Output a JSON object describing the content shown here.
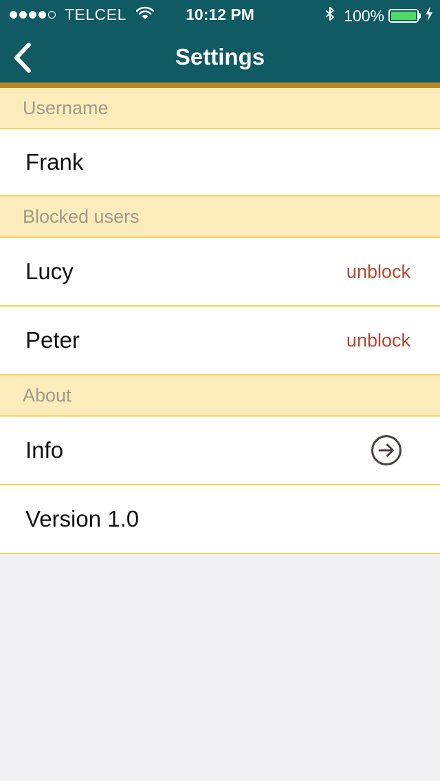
{
  "status_bar": {
    "carrier": "TELCEL",
    "signal_dots_filled": 4,
    "signal_dots_total": 5,
    "time": "10:12 PM",
    "battery_percent": "100%",
    "icons": [
      "wifi-icon",
      "bluetooth-icon",
      "battery-icon",
      "charging-bolt-icon"
    ]
  },
  "nav": {
    "title": "Settings",
    "back_icon": "chevron-left-icon"
  },
  "sections": {
    "username": {
      "header": "Username",
      "value": "Frank"
    },
    "blocked": {
      "header": "Blocked users",
      "users": [
        {
          "name": "Lucy",
          "action": "unblock"
        },
        {
          "name": "Peter",
          "action": "unblock"
        }
      ]
    },
    "about": {
      "header": "About",
      "info_label": "Info",
      "info_icon": "arrow-right-circle-icon",
      "version_label": "Version 1.0"
    }
  },
  "colors": {
    "header_bg": "#105a63",
    "accent_bar": "#b98a22",
    "section_header_bg": "#fcecbb",
    "separator": "#f7d35a",
    "action_text": "#b8462f",
    "page_bg": "#efeff4"
  }
}
